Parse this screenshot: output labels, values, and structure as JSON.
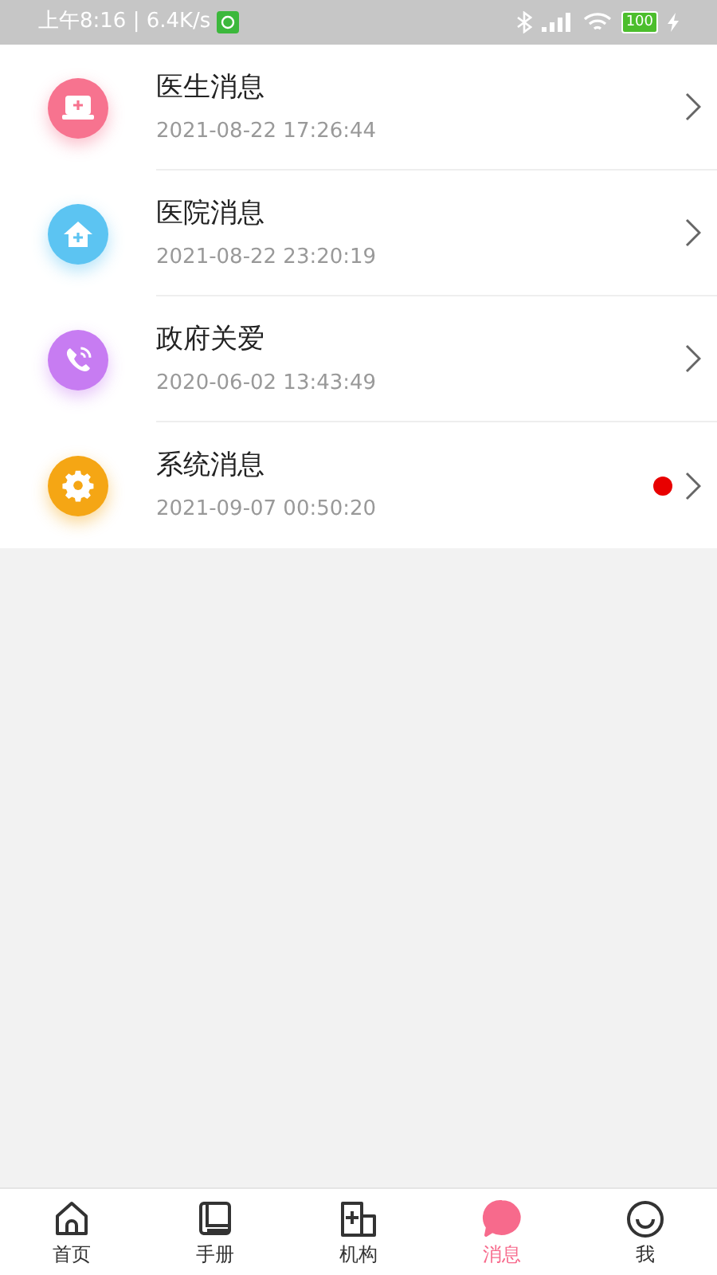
{
  "status_bar": {
    "time": "上午8:16 | 6.4K/s",
    "battery": "100"
  },
  "messages": [
    {
      "kind": "doctor",
      "title": "医生消息",
      "time": "2021-08-22 17:26:44",
      "unread": false
    },
    {
      "kind": "hospital",
      "title": "医院消息",
      "time": "2021-08-22 23:20:19",
      "unread": false
    },
    {
      "kind": "government",
      "title": "政府关爱",
      "time": "2020-06-02 13:43:49",
      "unread": false
    },
    {
      "kind": "system",
      "title": "系统消息",
      "time": "2021-09-07 00:50:20",
      "unread": true
    }
  ],
  "tabs": [
    {
      "kind": "home",
      "label": "首页",
      "selected": false
    },
    {
      "kind": "handbook",
      "label": "手册",
      "selected": false
    },
    {
      "kind": "institution",
      "label": "机构",
      "selected": false
    },
    {
      "kind": "messages",
      "label": "消息",
      "selected": true
    },
    {
      "kind": "me",
      "label": "我",
      "selected": false
    }
  ]
}
